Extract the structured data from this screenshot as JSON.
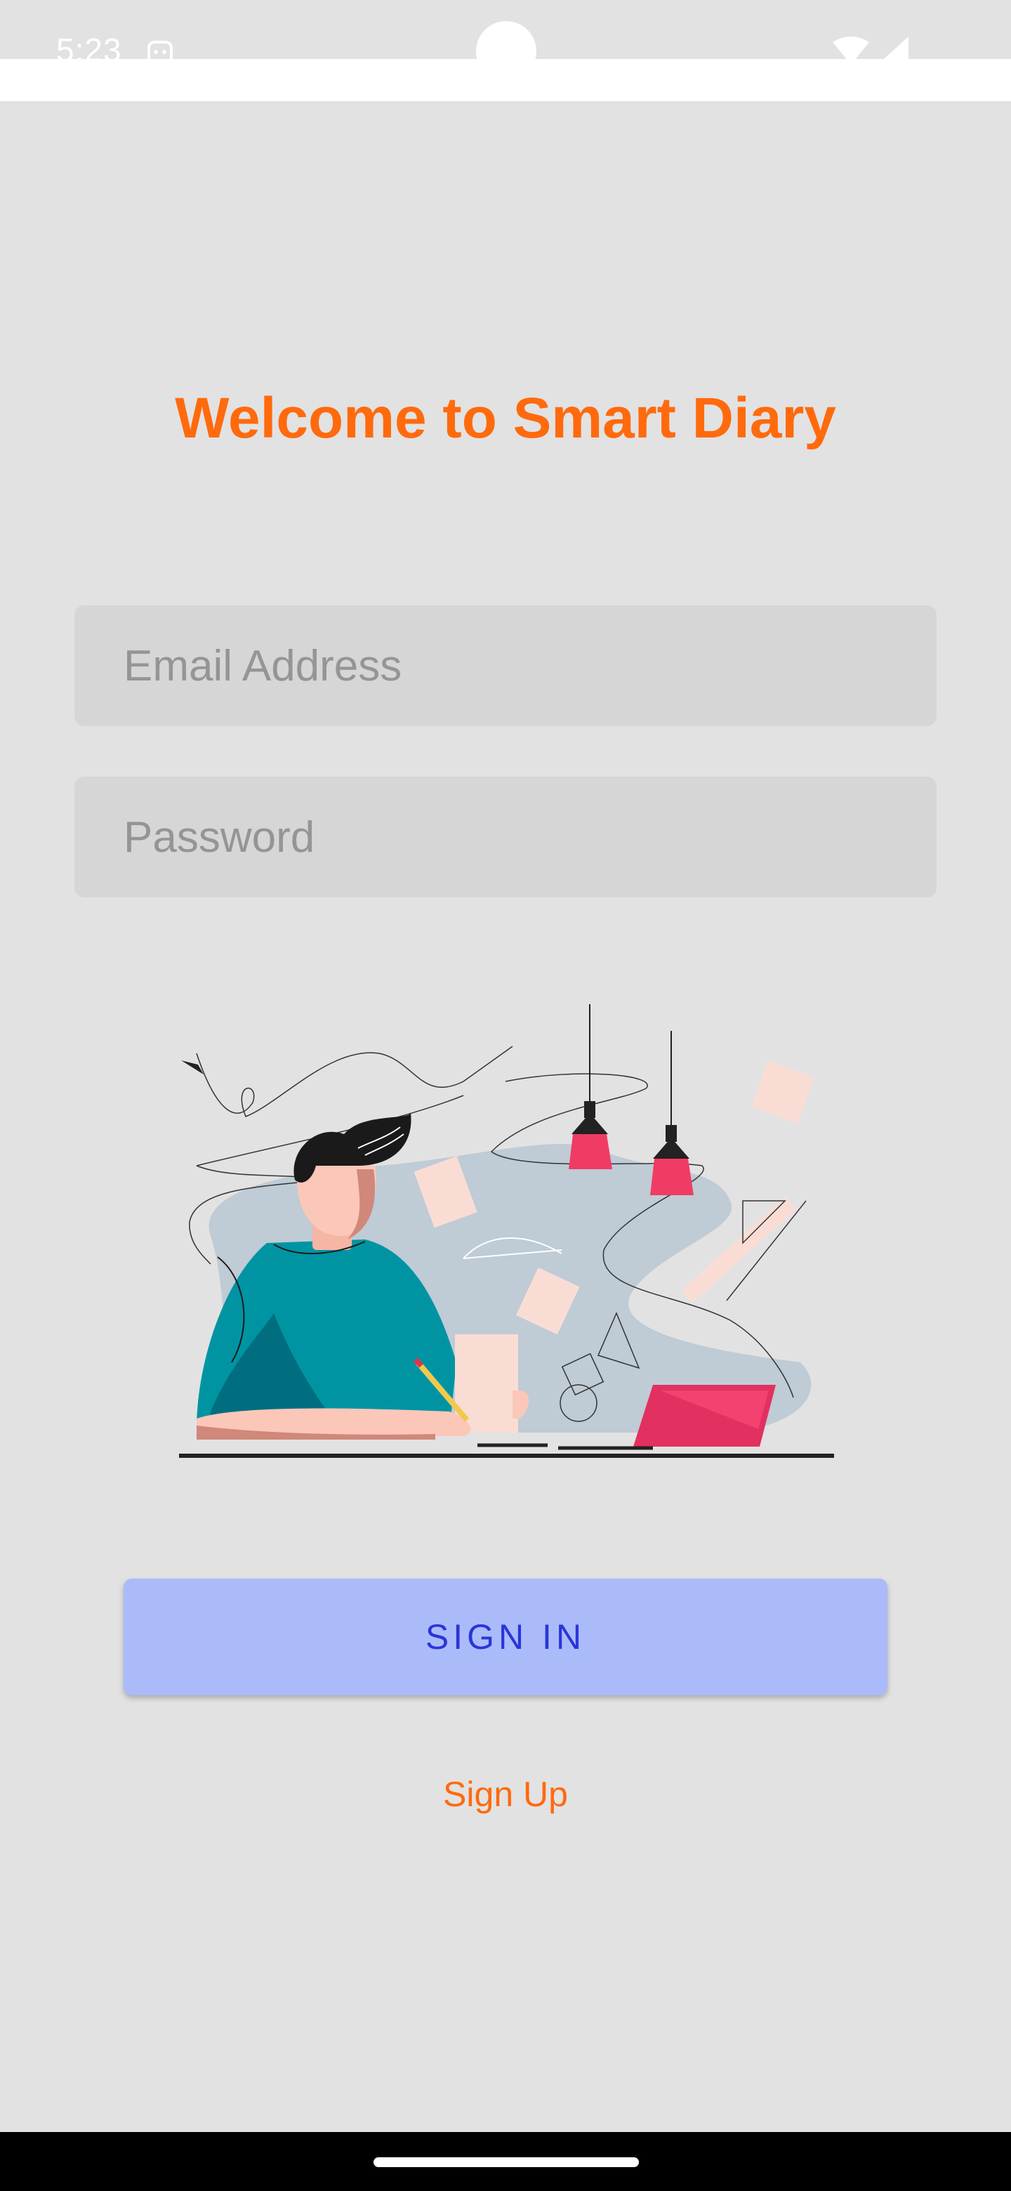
{
  "status_bar": {
    "time": "5:23",
    "icons": [
      "app-notification-icon",
      "wifi-icon",
      "signal-icon"
    ]
  },
  "login": {
    "title": "Welcome to Smart Diary",
    "email": {
      "placeholder": "Email Address",
      "value": ""
    },
    "password": {
      "placeholder": "Password",
      "value": ""
    },
    "illustration": "person-writing-at-desk",
    "sign_in_label": "SIGN IN",
    "sign_up_label": "Sign Up"
  },
  "colors": {
    "background": "#e2e2e2",
    "accent": "#ff6a0d",
    "button_bg": "#abbbfa",
    "button_text": "#2a35d9",
    "field_bg": "#d6d6d6"
  }
}
